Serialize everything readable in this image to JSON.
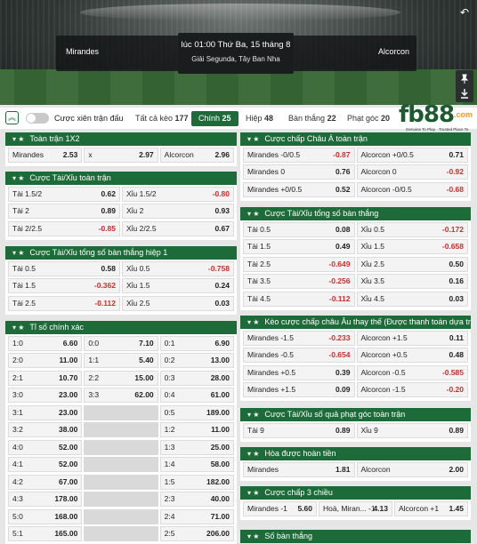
{
  "match": {
    "home": "Mirandes",
    "away": "Alcorcon",
    "time": "lúc 01:00 Thứ Ba, 15 tháng 8",
    "league": "Giải Segunda, Tây Ban Nha"
  },
  "icons": {
    "back": "↶",
    "pin": "📌",
    "download": "⤓",
    "collapse": "︽"
  },
  "tabs": {
    "toggle_label": "Cược xiên trận đấu",
    "items": [
      {
        "label": "Tất cả kèo",
        "count": "177"
      },
      {
        "label": "Chính",
        "count": "25"
      },
      {
        "label": "Hiệp",
        "count": "48"
      },
      {
        "label": "Bàn thắng",
        "count": "22"
      },
      {
        "label": "Phạt góc",
        "count": "20"
      }
    ]
  },
  "logo": {
    "text": "fb88",
    "suffix": ".com",
    "tagline": "Genuine To Play · Trusted Place To Bet"
  },
  "colors": {
    "brand": "#1d6b39",
    "negative": "#d52a2a"
  },
  "left_sections": [
    {
      "title": "Toàn trận 1X2",
      "rows": [
        [
          [
            "Mirandes",
            "2.53"
          ],
          [
            "x",
            "2.97"
          ],
          [
            "Alcorcon",
            "2.96"
          ]
        ]
      ]
    },
    {
      "title": "Cược Tài/Xỉu toàn trận",
      "rows": [
        [
          [
            "Tài 1.5/2",
            "0.62"
          ],
          [
            "Xỉu 1.5/2",
            "-0.80"
          ]
        ],
        [
          [
            "Tài 2",
            "0.89"
          ],
          [
            "Xỉu 2",
            "0.93"
          ]
        ],
        [
          [
            "Tài 2/2.5",
            "-0.85"
          ],
          [
            "Xỉu 2/2.5",
            "0.67"
          ]
        ]
      ]
    },
    {
      "title": "Cược Tài/Xỉu tổng số bàn thắng hiệp 1",
      "rows": [
        [
          [
            "Tài 0.5",
            "0.58"
          ],
          [
            "Xỉu 0.5",
            "-0.758"
          ]
        ],
        [
          [
            "Tài 1.5",
            "-0.362"
          ],
          [
            "Xỉu 1.5",
            "0.24"
          ]
        ],
        [
          [
            "Tài 2.5",
            "-0.112"
          ],
          [
            "Xỉu 2.5",
            "0.03"
          ]
        ]
      ]
    },
    {
      "title": "Tỉ số chính xác",
      "rows": [
        [
          [
            "1:0",
            "6.60"
          ],
          [
            "0:0",
            "7.10"
          ],
          [
            "0:1",
            "6.90"
          ]
        ],
        [
          [
            "2:0",
            "11.00"
          ],
          [
            "1:1",
            "5.40"
          ],
          [
            "0:2",
            "13.00"
          ]
        ],
        [
          [
            "2:1",
            "10.70"
          ],
          [
            "2:2",
            "15.00"
          ],
          [
            "0:3",
            "28.00"
          ]
        ],
        [
          [
            "3:0",
            "23.00"
          ],
          [
            "3:3",
            "62.00"
          ],
          [
            "0:4",
            "61.00"
          ]
        ],
        [
          [
            "3:1",
            "23.00"
          ],
          null,
          [
            "0:5",
            "189.00"
          ]
        ],
        [
          [
            "3:2",
            "38.00"
          ],
          null,
          [
            "1:2",
            "11.00"
          ]
        ],
        [
          [
            "4:0",
            "52.00"
          ],
          null,
          [
            "1:3",
            "25.00"
          ]
        ],
        [
          [
            "4:1",
            "52.00"
          ],
          null,
          [
            "1:4",
            "58.00"
          ]
        ],
        [
          [
            "4:2",
            "67.00"
          ],
          null,
          [
            "1:5",
            "182.00"
          ]
        ],
        [
          [
            "4:3",
            "178.00"
          ],
          null,
          [
            "2:3",
            "40.00"
          ]
        ],
        [
          [
            "5:0",
            "168.00"
          ],
          null,
          [
            "2:4",
            "71.00"
          ]
        ],
        [
          [
            "5:1",
            "165.00"
          ],
          null,
          [
            "2:5",
            "206.00"
          ]
        ]
      ]
    }
  ],
  "right_sections": [
    {
      "title": "Cược chấp Châu Á toàn trận",
      "rows": [
        [
          [
            "Mirandes -0/0.5",
            "-0.87"
          ],
          [
            "Alcorcon +0/0.5",
            "0.71"
          ]
        ],
        [
          [
            "Mirandes 0",
            "0.76"
          ],
          [
            "Alcorcon 0",
            "-0.92"
          ]
        ],
        [
          [
            "Mirandes +0/0.5",
            "0.52"
          ],
          [
            "Alcorcon -0/0.5",
            "-0.68"
          ]
        ]
      ]
    },
    {
      "title": "Cược Tài/Xỉu tổng số bàn thắng",
      "rows": [
        [
          [
            "Tài 0.5",
            "0.08"
          ],
          [
            "Xỉu 0.5",
            "-0.172"
          ]
        ],
        [
          [
            "Tài 1.5",
            "0.49"
          ],
          [
            "Xỉu 1.5",
            "-0.658"
          ]
        ],
        [
          [
            "Tài 2.5",
            "-0.649"
          ],
          [
            "Xỉu 2.5",
            "0.50"
          ]
        ],
        [
          [
            "Tài 3.5",
            "-0.256"
          ],
          [
            "Xỉu 3.5",
            "0.16"
          ]
        ],
        [
          [
            "Tài 4.5",
            "-0.112"
          ],
          [
            "Xỉu 4.5",
            "0.03"
          ]
        ]
      ]
    },
    {
      "title": "Kèo cược chấp châu Âu thay thế (Được thanh toán dựa trên tỷ...",
      "rows": [
        [
          [
            "Mirandes -1.5",
            "-0.233"
          ],
          [
            "Alcorcon +1.5",
            "0.11"
          ]
        ],
        [
          [
            "Mirandes -0.5",
            "-0.654"
          ],
          [
            "Alcorcon +0.5",
            "0.48"
          ]
        ],
        [
          [
            "Mirandes +0.5",
            "0.39"
          ],
          [
            "Alcorcon -0.5",
            "-0.585"
          ]
        ],
        [
          [
            "Mirandes +1.5",
            "0.09"
          ],
          [
            "Alcorcon -1.5",
            "-0.20"
          ]
        ]
      ]
    },
    {
      "title": "Cược Tài/Xỉu số quả phạt góc toàn trận",
      "rows": [
        [
          [
            "Tài 9",
            "0.89"
          ],
          [
            "Xỉu 9",
            "0.89"
          ]
        ]
      ]
    },
    {
      "title": "Hòa được hoàn tiền",
      "rows": [
        [
          [
            "Mirandes",
            "1.81"
          ],
          [
            "Alcorcon",
            "2.00"
          ]
        ]
      ]
    },
    {
      "title": "Cược chấp 3 chiều",
      "rows": [
        [
          [
            "Mirandes -1",
            "5.60"
          ],
          [
            "Hoà, Miran... -1",
            "4.13"
          ],
          [
            "Alcorcon +1",
            "1.45"
          ]
        ]
      ]
    },
    {
      "title": "Số bàn thắng",
      "rows": []
    }
  ]
}
